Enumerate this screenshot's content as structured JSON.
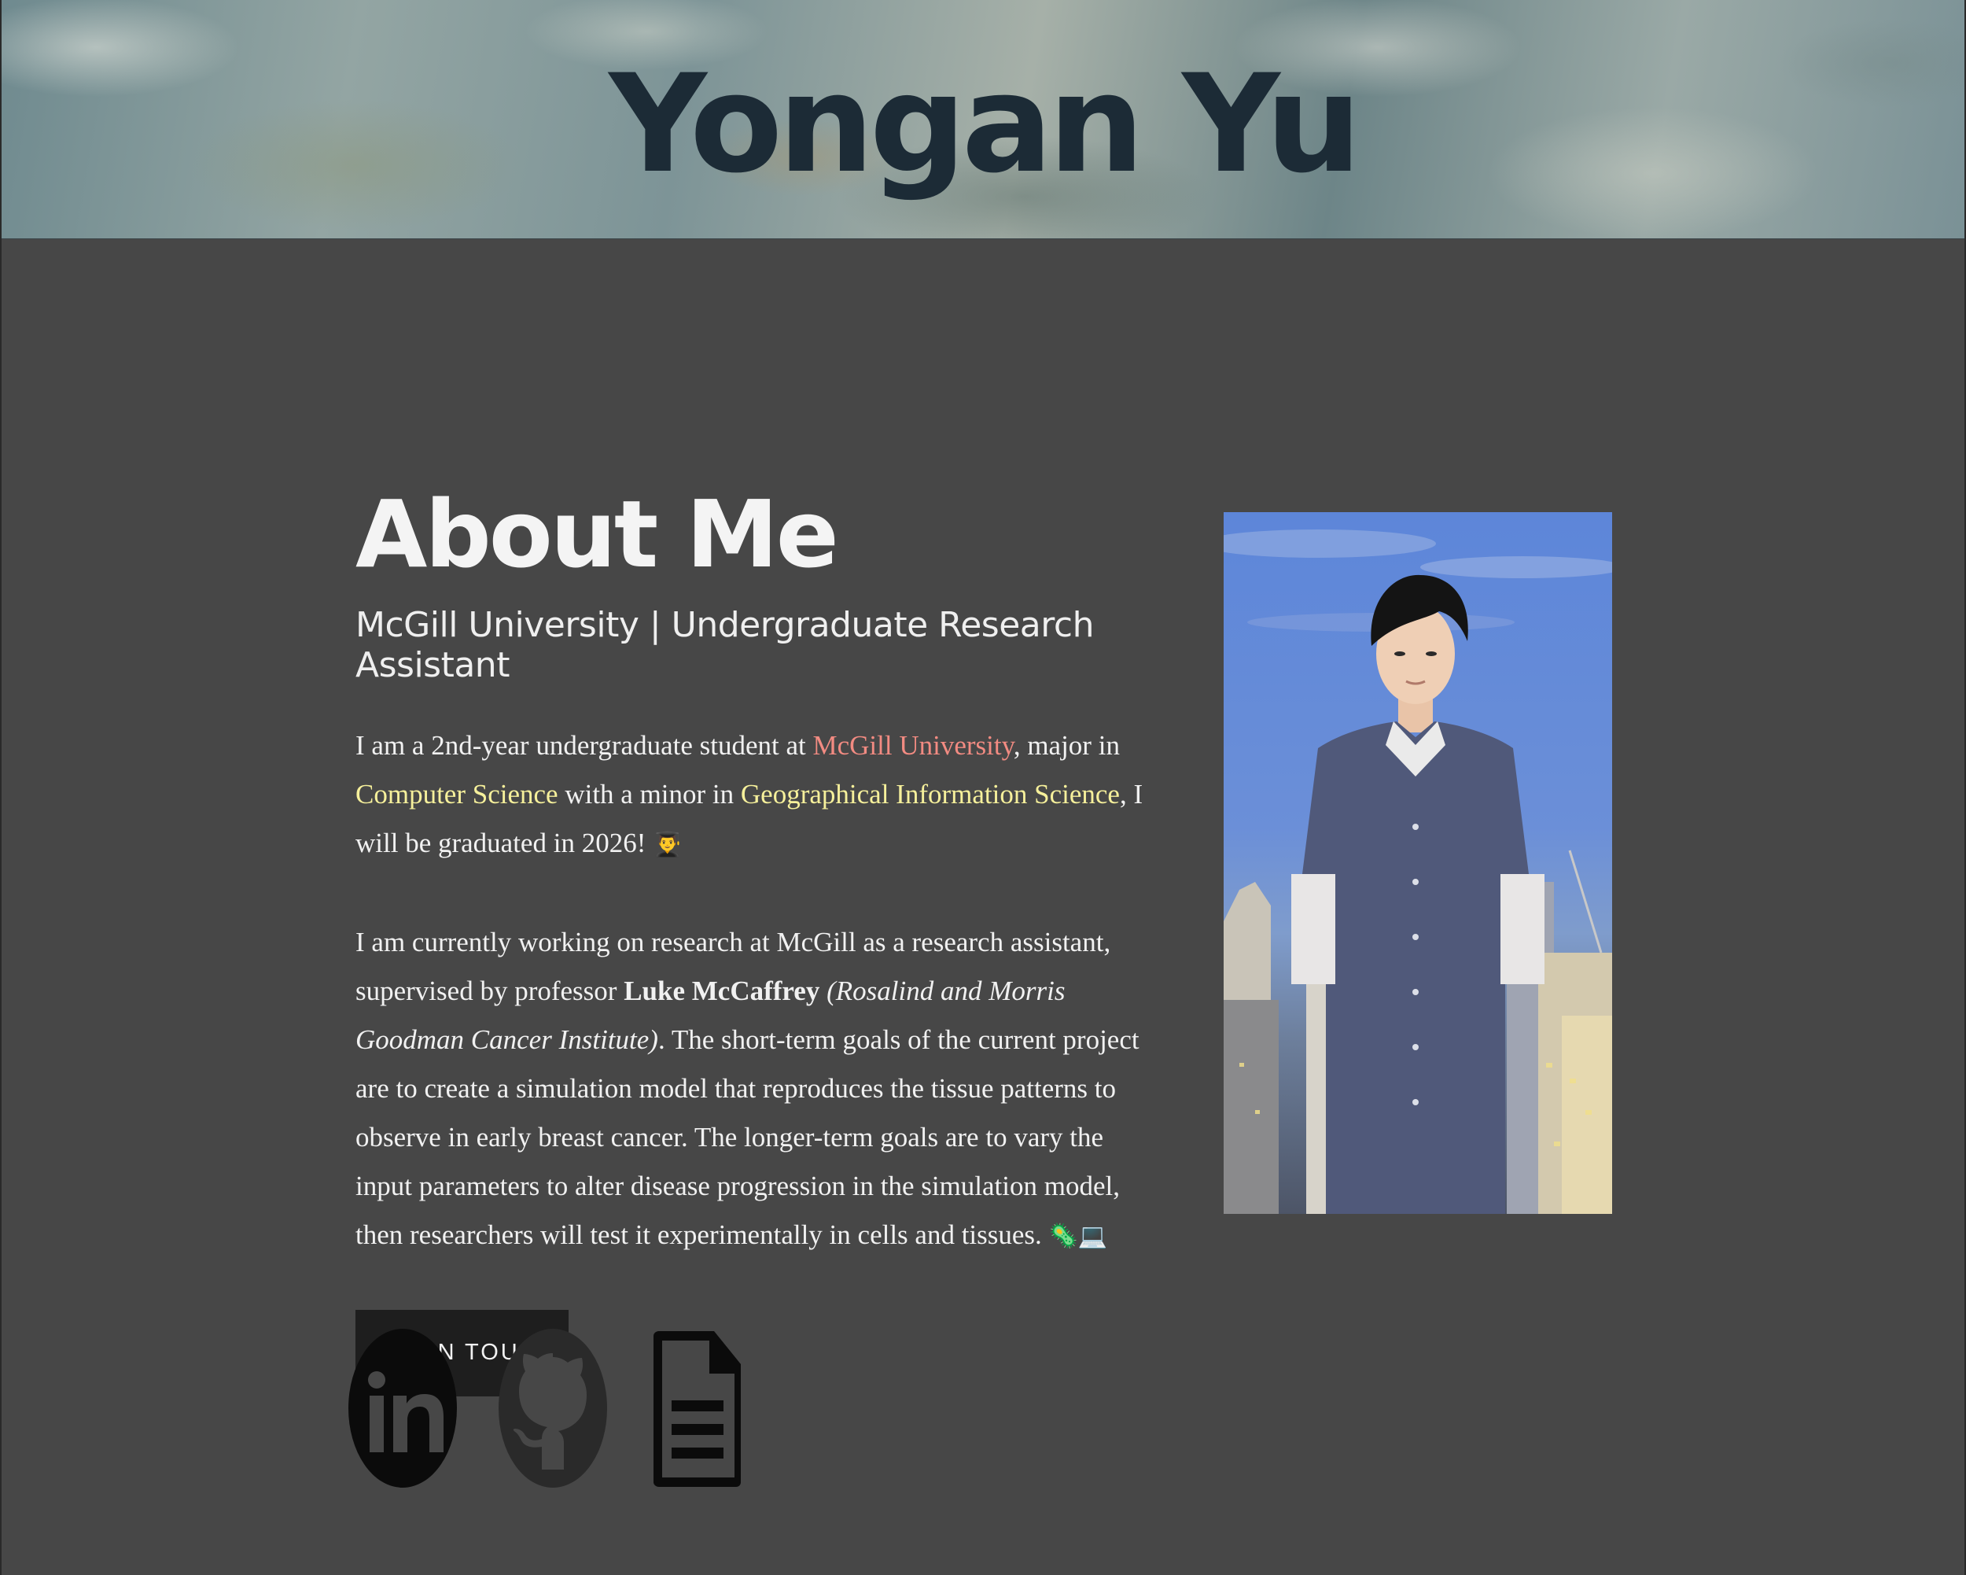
{
  "header": {
    "title": "Yongan Yu"
  },
  "about": {
    "heading": "About Me",
    "subtitle": "McGill University | Undergraduate Research Assistant",
    "para1": {
      "t1": "I am a 2nd-year undergraduate student at ",
      "university": "McGill University",
      "t2": ", major in ",
      "major": "Computer Science",
      "t3": " with a minor in ",
      "minor": "Geographical Information Science",
      "t4": ", I will be graduated in 2026! ",
      "emoji": "👨‍🎓"
    },
    "para2": {
      "t1": "I am currently working on research at McGill as a research assistant, supervised by professor ",
      "professor": "Luke McCaffrey",
      "institute": "(Rosalind and Morris Goodman Cancer Institute)",
      "t2": ". The short-term goals of the current project are to create a simulation model that reproduces the tissue patterns to observe in early breast cancer. The longer-term goals are to vary the input parameters to alter disease progression in the simulation model, then researchers will test it experimentally in cells and tissues. ",
      "emoji": "🦠💻"
    },
    "cta_label": "GET IN TOUCH"
  },
  "social": {
    "linkedin": "linkedin-icon",
    "github": "github-icon",
    "resume": "document-icon"
  },
  "photo": {
    "subject": "portrait-photo"
  },
  "colors": {
    "background": "#474747",
    "title": "#1c2b36",
    "highlight_red": "#f28b82",
    "highlight_yellow": "#f6f09b",
    "button": "#1e1e1e"
  }
}
